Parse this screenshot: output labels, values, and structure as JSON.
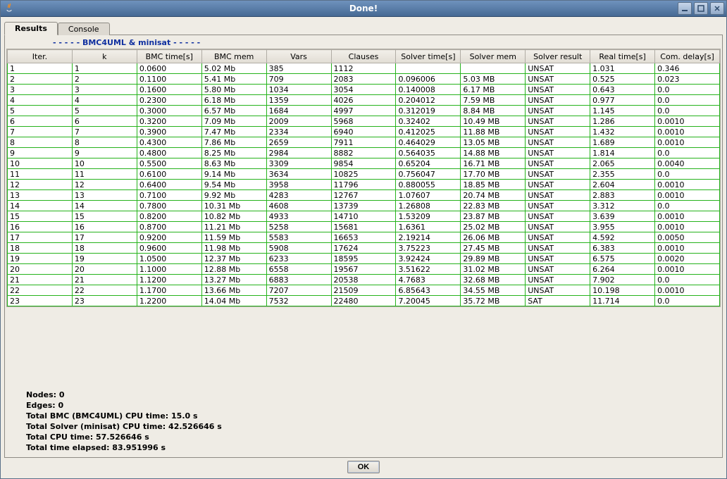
{
  "window": {
    "title": "Done!"
  },
  "tabs": {
    "results": "Results",
    "console": "Console"
  },
  "section_label": "-  -  -  -  -  BMC4UML & minisat  -  -  -  -  -",
  "columns": [
    "Iter.",
    "k",
    "BMC time[s]",
    "BMC mem",
    "Vars",
    "Clauses",
    "Solver time[s]",
    "Solver mem",
    "Solver result",
    "Real time[s]",
    "Com. delay[s]"
  ],
  "rows": [
    [
      "1",
      "1",
      "0.0600",
      "5.02 Mb",
      "385",
      "1112",
      "",
      "",
      "UNSAT",
      "1.031",
      "0.346"
    ],
    [
      "2",
      "2",
      "0.1100",
      "5.41 Mb",
      "709",
      "2083",
      "0.096006",
      "5.03 MB",
      "UNSAT",
      "0.525",
      "0.023"
    ],
    [
      "3",
      "3",
      "0.1600",
      "5.80 Mb",
      "1034",
      "3054",
      "0.140008",
      "6.17 MB",
      "UNSAT",
      "0.643",
      "0.0"
    ],
    [
      "4",
      "4",
      "0.2300",
      "6.18 Mb",
      "1359",
      "4026",
      "0.204012",
      "7.59 MB",
      "UNSAT",
      "0.977",
      "0.0"
    ],
    [
      "5",
      "5",
      "0.3000",
      "6.57 Mb",
      "1684",
      "4997",
      "0.312019",
      "8.84 MB",
      "UNSAT",
      "1.145",
      "0.0"
    ],
    [
      "6",
      "6",
      "0.3200",
      "7.09 Mb",
      "2009",
      "5968",
      "0.32402",
      "10.49 MB",
      "UNSAT",
      "1.286",
      "0.0010"
    ],
    [
      "7",
      "7",
      "0.3900",
      "7.47 Mb",
      "2334",
      "6940",
      "0.412025",
      "11.88 MB",
      "UNSAT",
      "1.432",
      "0.0010"
    ],
    [
      "8",
      "8",
      "0.4300",
      "7.86 Mb",
      "2659",
      "7911",
      "0.464029",
      "13.05 MB",
      "UNSAT",
      "1.689",
      "0.0010"
    ],
    [
      "9",
      "9",
      "0.4800",
      "8.25 Mb",
      "2984",
      "8882",
      "0.564035",
      "14.88 MB",
      "UNSAT",
      "1.814",
      "0.0"
    ],
    [
      "10",
      "10",
      "0.5500",
      "8.63 Mb",
      "3309",
      "9854",
      "0.65204",
      "16.71 MB",
      "UNSAT",
      "2.065",
      "0.0040"
    ],
    [
      "11",
      "11",
      "0.6100",
      "9.14 Mb",
      "3634",
      "10825",
      "0.756047",
      "17.70 MB",
      "UNSAT",
      "2.355",
      "0.0"
    ],
    [
      "12",
      "12",
      "0.6400",
      "9.54 Mb",
      "3958",
      "11796",
      "0.880055",
      "18.85 MB",
      "UNSAT",
      "2.604",
      "0.0010"
    ],
    [
      "13",
      "13",
      "0.7100",
      "9.92 Mb",
      "4283",
      "12767",
      "1.07607",
      "20.74 MB",
      "UNSAT",
      "2.883",
      "0.0010"
    ],
    [
      "14",
      "14",
      "0.7800",
      "10.31 Mb",
      "4608",
      "13739",
      "1.26808",
      "22.83 MB",
      "UNSAT",
      "3.312",
      "0.0"
    ],
    [
      "15",
      "15",
      "0.8200",
      "10.82 Mb",
      "4933",
      "14710",
      "1.53209",
      "23.87 MB",
      "UNSAT",
      "3.639",
      "0.0010"
    ],
    [
      "16",
      "16",
      "0.8700",
      "11.21 Mb",
      "5258",
      "15681",
      "1.6361",
      "25.02 MB",
      "UNSAT",
      "3.955",
      "0.0010"
    ],
    [
      "17",
      "17",
      "0.9200",
      "11.59 Mb",
      "5583",
      "16653",
      "2.19214",
      "26.06 MB",
      "UNSAT",
      "4.592",
      "0.0050"
    ],
    [
      "18",
      "18",
      "0.9600",
      "11.98 Mb",
      "5908",
      "17624",
      "3.75223",
      "27.45 MB",
      "UNSAT",
      "6.383",
      "0.0010"
    ],
    [
      "19",
      "19",
      "1.0500",
      "12.37 Mb",
      "6233",
      "18595",
      "3.92424",
      "29.89 MB",
      "UNSAT",
      "6.575",
      "0.0020"
    ],
    [
      "20",
      "20",
      "1.1000",
      "12.88 Mb",
      "6558",
      "19567",
      "3.51622",
      "31.02 MB",
      "UNSAT",
      "6.264",
      "0.0010"
    ],
    [
      "21",
      "21",
      "1.1200",
      "13.27 Mb",
      "6883",
      "20538",
      "4.7683",
      "32.68 MB",
      "UNSAT",
      "7.902",
      "0.0"
    ],
    [
      "22",
      "22",
      "1.1700",
      "13.66 Mb",
      "7207",
      "21509",
      "6.85643",
      "34.55 MB",
      "UNSAT",
      "10.198",
      "0.0010"
    ],
    [
      "23",
      "23",
      "1.2200",
      "14.04 Mb",
      "7532",
      "22480",
      "7.20045",
      "35.72 MB",
      "SAT",
      "11.714",
      "0.0"
    ]
  ],
  "summary": {
    "nodes": "Nodes: 0",
    "edges": "Edges: 0",
    "bmc_cpu": "Total BMC (BMC4UML) CPU time: 15.0 s",
    "solver_cpu": "Total Solver (minisat) CPU time: 42.526646 s",
    "total_cpu": "Total CPU time: 57.526646 s",
    "elapsed": "Total time elapsed: 83.951996 s"
  },
  "buttons": {
    "ok": "OK"
  }
}
